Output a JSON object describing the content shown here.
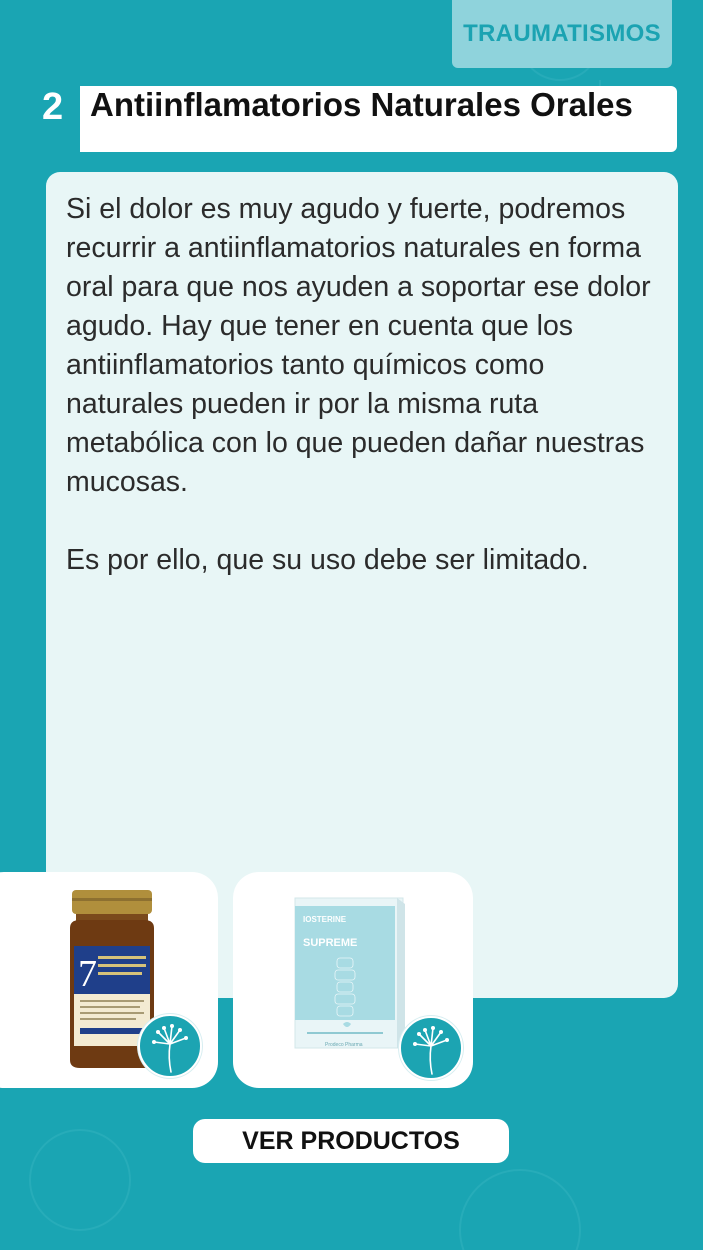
{
  "category": "TRAUMATISMOS",
  "section": {
    "number": "2",
    "title": "Antiinflamatorios Naturales Orales"
  },
  "content": {
    "paragraph_1": "Si el dolor es muy agudo y fuerte, podremos recurrir a antiinflamatorios naturales en forma oral para que nos ayuden a soportar ese dolor agudo. Hay que tener en cuenta que los antiinflamatorios tanto químicos como naturales pueden ir por la misma ruta metabólica con lo que pueden dañar nuestras mucosas.",
    "paragraph_2": "Es por ello, que su uso debe ser limitado."
  },
  "products": [
    {
      "image": "supplement-jar-icon",
      "label_number": "7",
      "label_lines": [
        "Joint Support & Comfort",
        "Flexibility & Mobility",
        "Targets Multiple Pathways"
      ],
      "badge": "dandelion-icon"
    },
    {
      "image": "supplement-box-icon",
      "brand": "IOSTERINE",
      "name": "SUPREME",
      "maker": "Prodeco Pharma",
      "badge": "dandelion-icon"
    }
  ],
  "cta": {
    "label": "VER PRODUCTOS"
  },
  "colors": {
    "background": "#1aa5b3",
    "tab": "#8fd3dc",
    "card": "#e8f6f6",
    "accent": "#1ca4b2"
  }
}
